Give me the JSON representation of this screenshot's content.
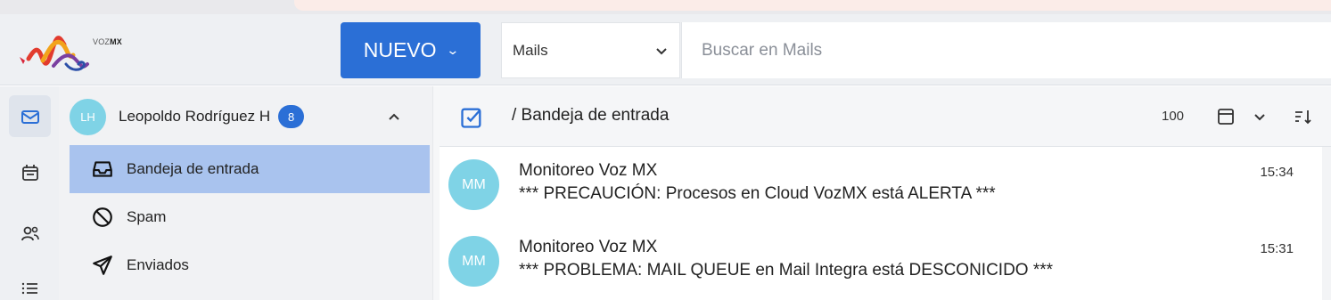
{
  "header": {
    "brand_prefix": "VOZ",
    "brand_suffix": "MX",
    "new_button_label": "NUEVO",
    "module_select_value": "Mails",
    "search_placeholder": "Buscar en Mails"
  },
  "account": {
    "initials": "LH",
    "name": "Leopoldo Rodríguez H",
    "unread_count": "8"
  },
  "folders": [
    {
      "label": "Bandeja de entrada",
      "icon": "inbox-icon",
      "active": true
    },
    {
      "label": "Spam",
      "icon": "spam-icon",
      "active": false
    },
    {
      "label": "Enviados",
      "icon": "sent-icon",
      "active": false
    }
  ],
  "rail": [
    {
      "icon": "mail-icon",
      "active": true
    },
    {
      "icon": "calendar-icon",
      "active": false
    },
    {
      "icon": "contacts-icon",
      "active": false
    },
    {
      "icon": "list-icon",
      "active": false
    }
  ],
  "toolbar": {
    "path": "/ Bandeja de entrada",
    "page_size": "100"
  },
  "messages": [
    {
      "initials": "MM",
      "sender": "Monitoreo Voz MX",
      "subject": "*** PRECAUCIÓN: Procesos en Cloud VozMX está ALERTA ***",
      "time": "15:34"
    },
    {
      "initials": "MM",
      "sender": "Monitoreo Voz MX",
      "subject": "*** PROBLEMA: MAIL QUEUE en Mail Integra está DESCONICIDO ***",
      "time": "15:31"
    }
  ],
  "colors": {
    "accent": "#2b6fd6",
    "avatar": "#7fd3e6",
    "active_folder": "#a9c3ee"
  }
}
